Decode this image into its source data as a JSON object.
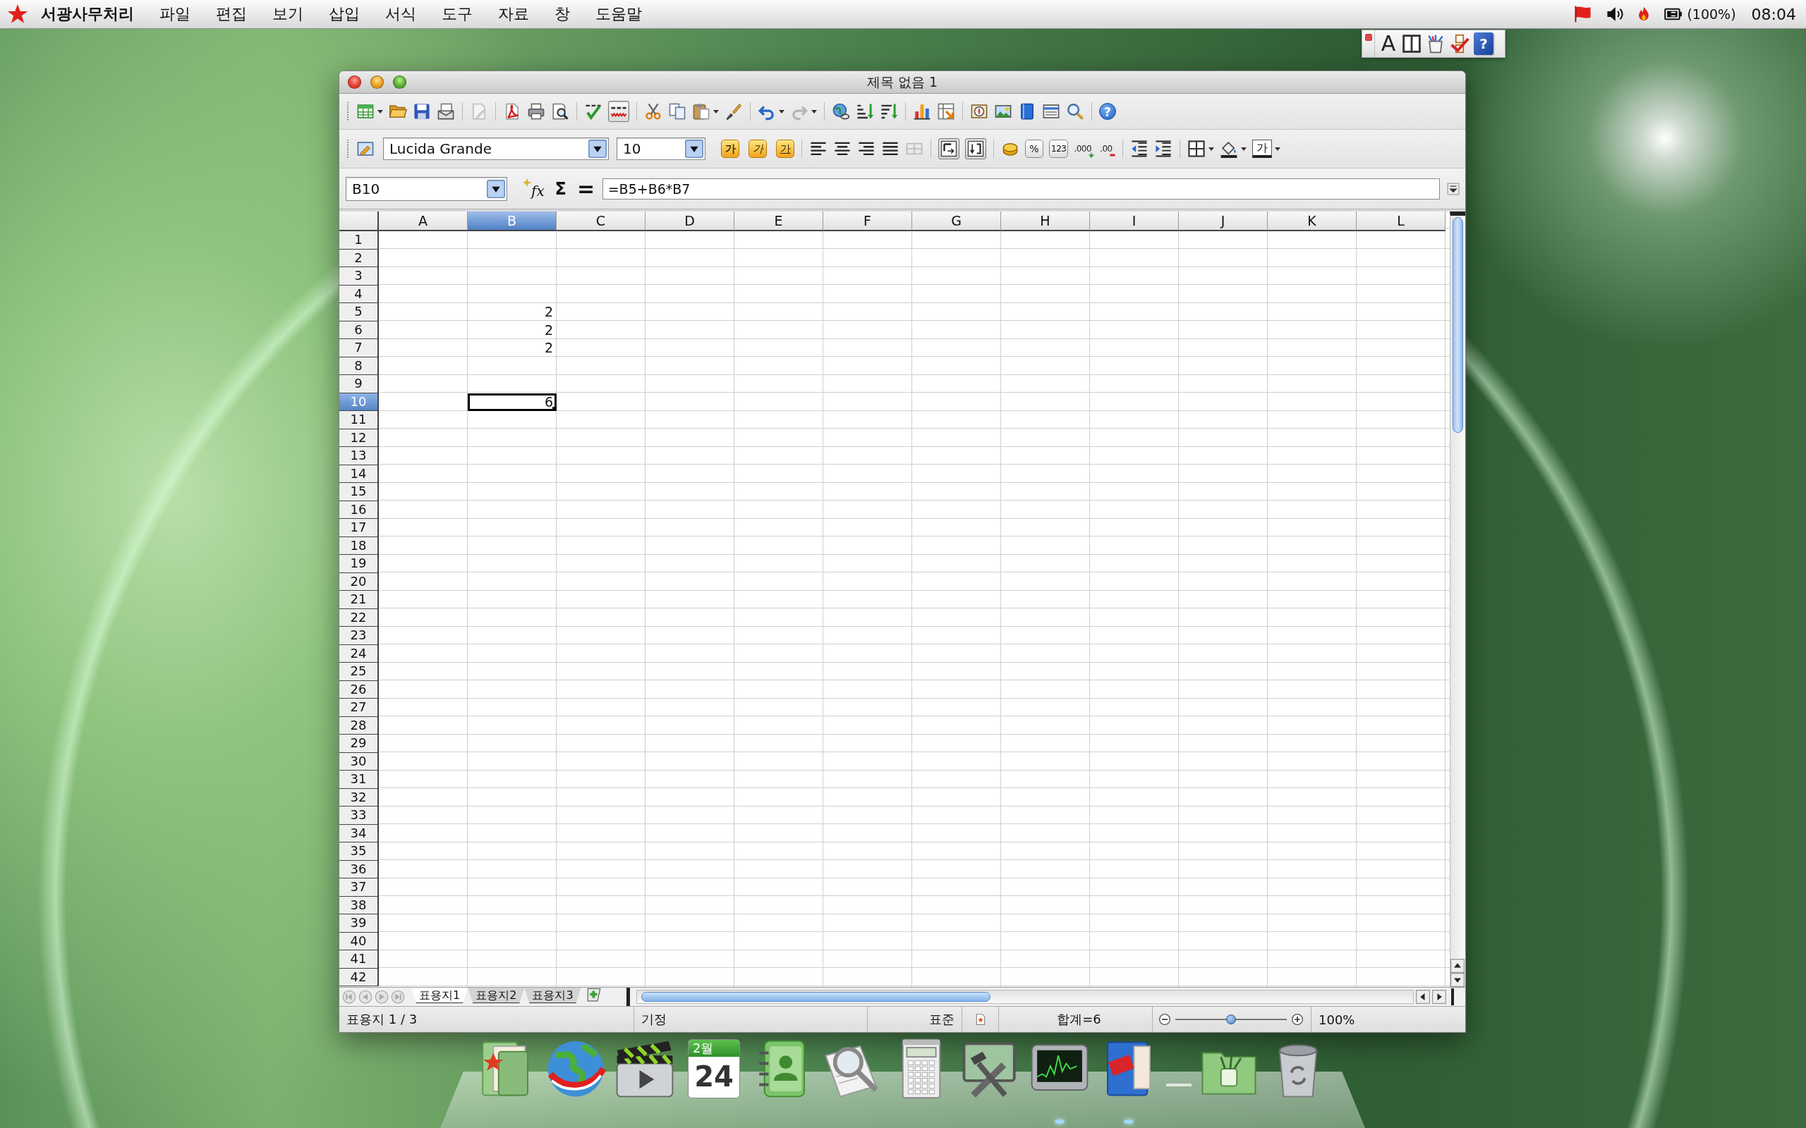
{
  "menu_bar": {
    "app_name": "서광사무처리",
    "items": [
      "파일",
      "편집",
      "보기",
      "삽입",
      "서식",
      "도구",
      "자료",
      "창",
      "도움말"
    ],
    "battery": "(100%)",
    "clock": "08:04"
  },
  "input_toolbar": {
    "mode": "A",
    "help": "?"
  },
  "window": {
    "title": "제목 없음 1"
  },
  "standard_toolbar": {
    "auto_spellcheck": {
      "on": true
    },
    "help": "?"
  },
  "format_toolbar": {
    "font_name": "Lucida Grande",
    "font_size": "10",
    "bold": "가",
    "italic": "가",
    "underline": "가",
    "percent": "%",
    "number": "123",
    "add_decimal": ".000",
    "delete_decimal": ".00",
    "font_color": "가",
    "toggles": [
      {
        "on": true
      },
      {
        "on": true
      }
    ]
  },
  "formula_bar": {
    "name_box": "B10",
    "function_wizard": "fx",
    "sum": "Σ",
    "equals": "=",
    "formula": "=B5+B6*B7"
  },
  "sheet": {
    "columns": [
      {
        "label": "A",
        "selected": false
      },
      {
        "label": "B",
        "selected": true
      },
      {
        "label": "C",
        "selected": false
      },
      {
        "label": "D",
        "selected": false
      },
      {
        "label": "E",
        "selected": false
      },
      {
        "label": "F",
        "selected": false
      },
      {
        "label": "G",
        "selected": false
      },
      {
        "label": "H",
        "selected": false
      },
      {
        "label": "I",
        "selected": false
      },
      {
        "label": "J",
        "selected": false
      },
      {
        "label": "K",
        "selected": false
      },
      {
        "label": "L",
        "selected": false
      }
    ],
    "rows": [
      {
        "label": "1",
        "selected": false
      },
      {
        "label": "2",
        "selected": false
      },
      {
        "label": "3",
        "selected": false
      },
      {
        "label": "4",
        "selected": false
      },
      {
        "label": "5",
        "selected": false,
        "cells": [
          null,
          {
            "value": "2",
            "selected": false
          }
        ]
      },
      {
        "label": "6",
        "selected": false,
        "cells": [
          null,
          {
            "value": "2",
            "selected": false
          }
        ]
      },
      {
        "label": "7",
        "selected": false,
        "cells": [
          null,
          {
            "value": "2",
            "selected": false
          }
        ]
      },
      {
        "label": "8",
        "selected": false
      },
      {
        "label": "9",
        "selected": false
      },
      {
        "label": "10",
        "selected": true,
        "cells": [
          null,
          {
            "value": "6",
            "selected": true
          }
        ]
      },
      {
        "label": "11",
        "selected": false
      },
      {
        "label": "12",
        "selected": false
      },
      {
        "label": "13",
        "selected": false
      },
      {
        "label": "14",
        "selected": false
      },
      {
        "label": "15",
        "selected": false
      },
      {
        "label": "16",
        "selected": false
      },
      {
        "label": "17",
        "selected": false
      },
      {
        "label": "18",
        "selected": false
      },
      {
        "label": "19",
        "selected": false
      },
      {
        "label": "20",
        "selected": false
      },
      {
        "label": "21",
        "selected": false
      },
      {
        "label": "22",
        "selected": false
      },
      {
        "label": "23",
        "selected": false
      },
      {
        "label": "24",
        "selected": false
      },
      {
        "label": "25",
        "selected": false
      },
      {
        "label": "26",
        "selected": false
      },
      {
        "label": "27",
        "selected": false
      },
      {
        "label": "28",
        "selected": false
      },
      {
        "label": "29",
        "selected": false
      },
      {
        "label": "30",
        "selected": false
      },
      {
        "label": "31",
        "selected": false
      },
      {
        "label": "32",
        "selected": false
      },
      {
        "label": "33",
        "selected": false
      },
      {
        "label": "34",
        "selected": false
      },
      {
        "label": "35",
        "selected": false
      },
      {
        "label": "36",
        "selected": false
      },
      {
        "label": "37",
        "selected": false
      },
      {
        "label": "38",
        "selected": false
      },
      {
        "label": "39",
        "selected": false
      },
      {
        "label": "40",
        "selected": false
      },
      {
        "label": "41",
        "selected": false
      },
      {
        "label": "42",
        "selected": false
      }
    ]
  },
  "sheet_tabs": [
    {
      "label": "표용지1",
      "selected": true
    },
    {
      "label": "표용지2",
      "selected": false
    },
    {
      "label": "표용지3",
      "selected": false
    }
  ],
  "status_bar": {
    "sheet": "표용지 1 / 3",
    "page_style": "기정",
    "mode": "표준",
    "sum": "합계=6",
    "zoom": {
      "level": 0.5,
      "reading": "100%"
    }
  },
  "dock": [
    {
      "kind": "files",
      "running": false
    },
    {
      "kind": "browser",
      "running": false
    },
    {
      "kind": "video",
      "running": false
    },
    {
      "kind": "calendar",
      "running": false,
      "month": "2월",
      "day": "24"
    },
    {
      "kind": "contacts",
      "running": false
    },
    {
      "kind": "search",
      "running": false
    },
    {
      "kind": "calculator",
      "running": false
    },
    {
      "kind": "tools",
      "running": false
    },
    {
      "kind": "monitor",
      "running": true
    },
    {
      "kind": "office",
      "running": true
    },
    {
      "kind": "folder",
      "running": false
    },
    {
      "kind": "trash",
      "running": false
    }
  ]
}
